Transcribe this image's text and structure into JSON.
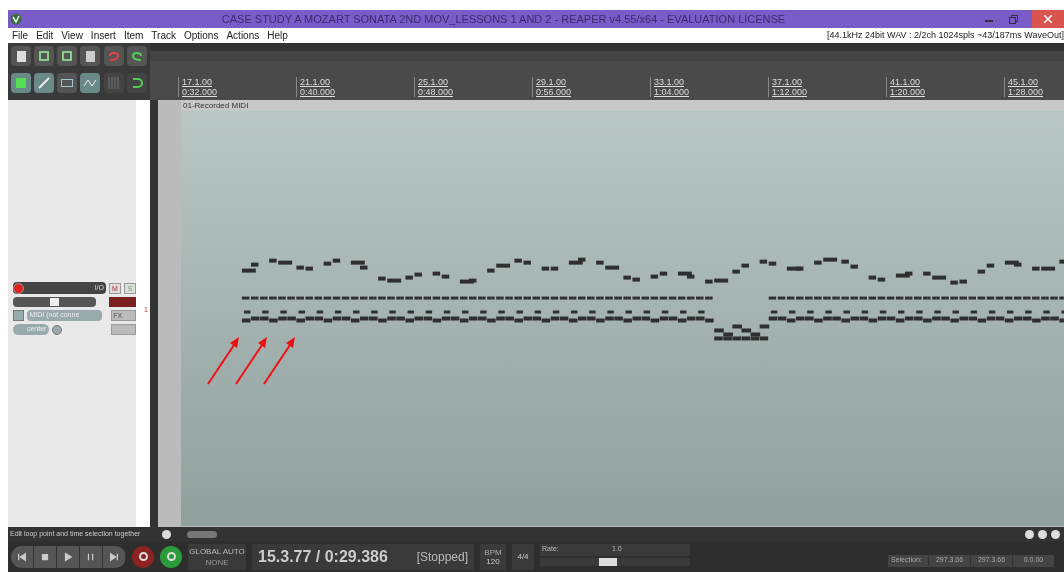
{
  "window": {
    "title": "CASE STUDY A MOZART SONATA 2ND MOV_LESSONS 1 AND 2 - REAPER v4.55/x64 - EVALUATION LICENSE"
  },
  "menu": [
    "File",
    "Edit",
    "View",
    "Insert",
    "Item",
    "Track",
    "Options",
    "Actions",
    "Help"
  ],
  "audio_status": "[44.1kHz 24bit WAV : 2/2ch 1024spls ~43/187ms WaveOut]",
  "ruler": [
    {
      "bar": "17.1.00",
      "time": "0:32.000"
    },
    {
      "bar": "21.1.00",
      "time": "0:40.000"
    },
    {
      "bar": "25.1.00",
      "time": "0:48.000"
    },
    {
      "bar": "29.1.00",
      "time": "0:56.000"
    },
    {
      "bar": "33.1.00",
      "time": "1:04.000"
    },
    {
      "bar": "37.1.00",
      "time": "1:12.000"
    },
    {
      "bar": "41.1.00",
      "time": "1:20.000"
    },
    {
      "bar": "45.1.00",
      "time": "1:28.000"
    }
  ],
  "item": {
    "name": "01-Recorded MIDI"
  },
  "track": {
    "number": "1",
    "record_armed": true,
    "io": "I/O",
    "mute": "M",
    "solo": "S",
    "volume": {
      "level": 0.5
    },
    "input": "MIDI (not conne",
    "fx": "FX",
    "pan": "center"
  },
  "hint": "Edit loop point and time selection together",
  "transport": {
    "time": "15.3.77 / 0:29.386",
    "state": "[Stopped]",
    "global_auto": "GLOBAL AUTO",
    "auto_mode": "NONE",
    "bpm_label": "BPM",
    "bpm": "120",
    "time_signature": "4/4",
    "rate_label": "Rate:",
    "rate": "1.0",
    "rate_slider": {
      "level": 0.45
    }
  },
  "selection": {
    "label": "Selection:",
    "values": [
      "297.3.66",
      "297.3.66",
      "0.0.00"
    ]
  }
}
